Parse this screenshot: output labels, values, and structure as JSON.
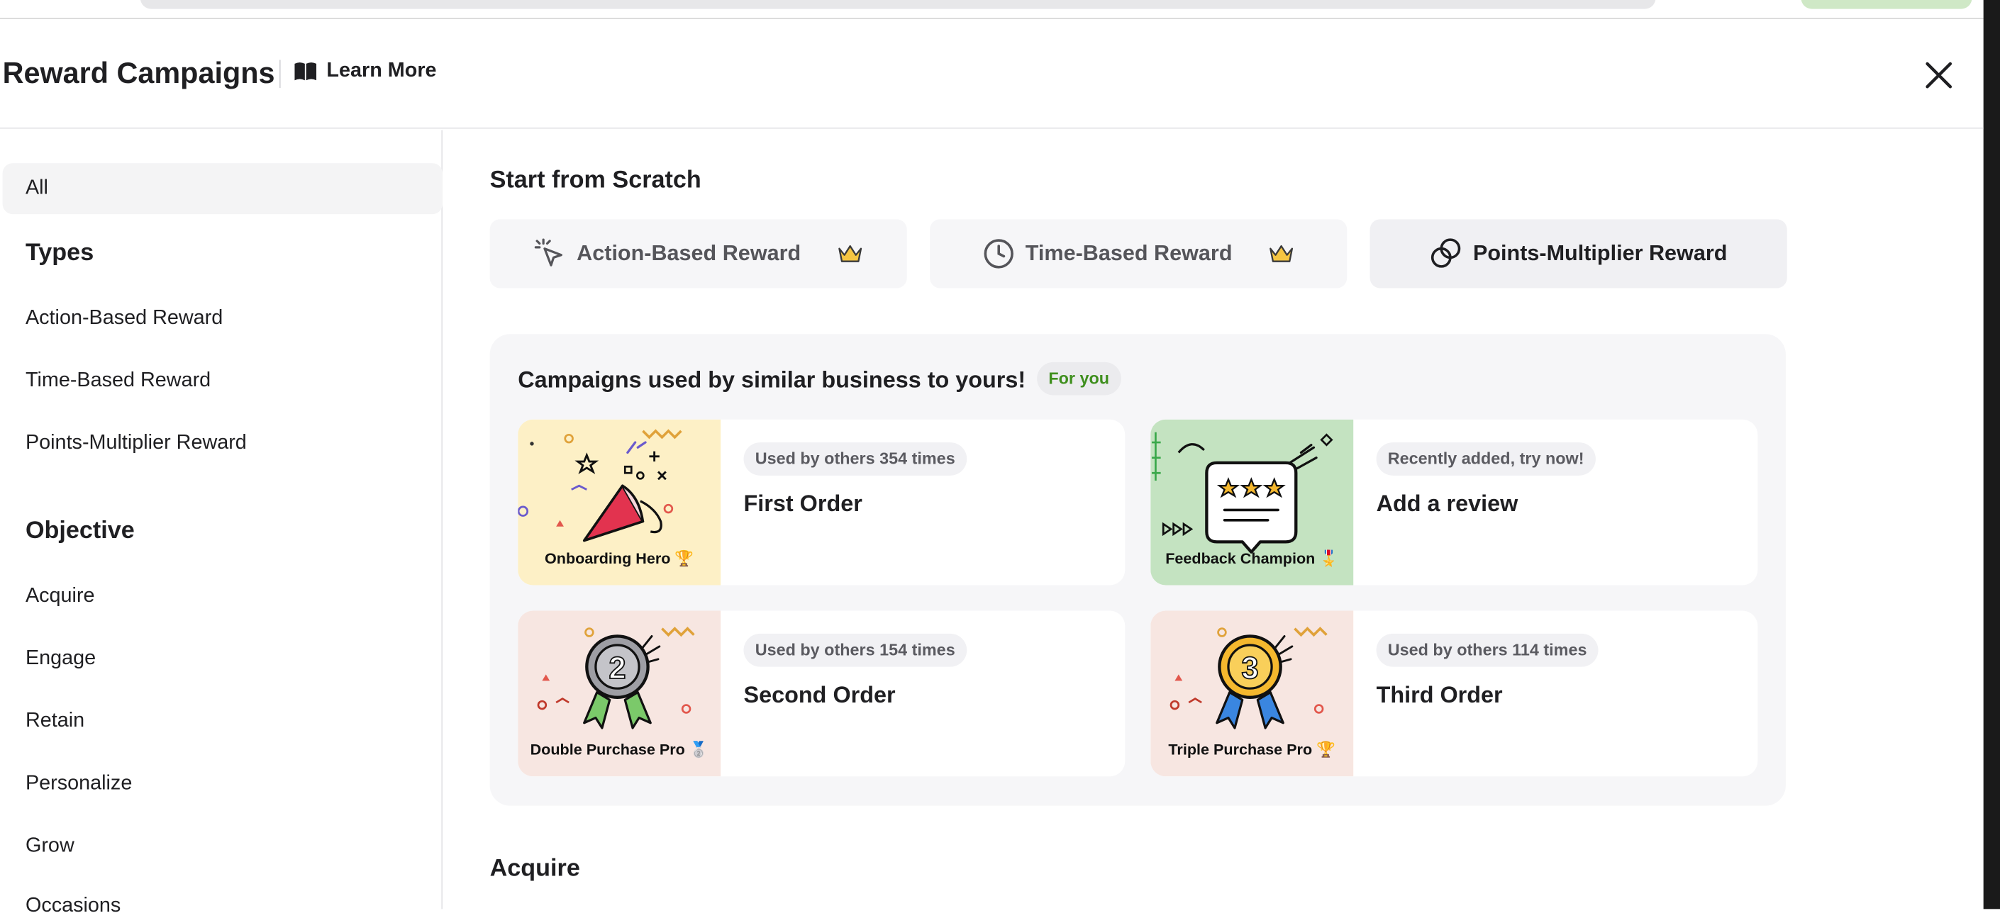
{
  "header": {
    "title": "Reward Campaigns",
    "learn_more": "Learn More"
  },
  "sidebar": {
    "all_label": "All",
    "types_heading": "Types",
    "types": [
      "Action-Based Reward",
      "Time-Based Reward",
      "Points-Multiplier Reward"
    ],
    "objective_heading": "Objective",
    "objectives": [
      "Acquire",
      "Engage",
      "Retain",
      "Personalize",
      "Grow",
      "Occasions"
    ]
  },
  "main": {
    "scratch_heading": "Start from Scratch",
    "type_buttons": [
      {
        "label": "Action-Based Reward",
        "icon": "cursor-click-icon",
        "premium": true
      },
      {
        "label": "Time-Based Reward",
        "icon": "clock-icon",
        "premium": true
      },
      {
        "label": "Points-Multiplier Reward",
        "icon": "coins-icon",
        "premium": false
      }
    ],
    "recommend_title": "Campaigns used by similar business to yours!",
    "for_you_badge": "For you",
    "campaigns": [
      {
        "thumb_label": "Onboarding Hero 🏆",
        "badge": "Used by others 354 times",
        "name": "First Order",
        "thumb_color": "#fdf0c6"
      },
      {
        "thumb_label": "Feedback Champion 🎖️",
        "badge": "Recently added, try now!",
        "name": "Add a review",
        "thumb_color": "#c4e3c1"
      },
      {
        "thumb_label": "Double Purchase Pro 🥈",
        "badge": "Used by others 154 times",
        "name": "Second Order",
        "thumb_color": "#f7e6e1"
      },
      {
        "thumb_label": "Triple Purchase Pro 🏆",
        "badge": "Used by others 114 times",
        "name": "Third Order",
        "thumb_color": "#f7e6e1"
      }
    ],
    "acquire_heading": "Acquire"
  },
  "colors": {
    "accent_green": "#3f8f1e",
    "crown_gold": "#f5c542"
  }
}
